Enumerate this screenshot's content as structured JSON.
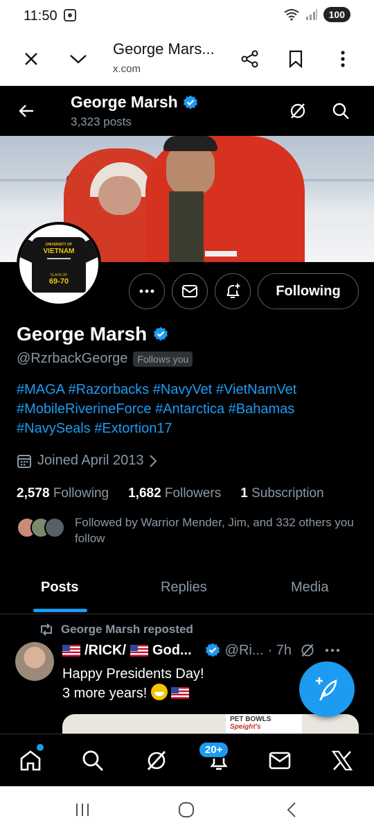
{
  "status_bar": {
    "time": "11:50",
    "battery": "100"
  },
  "browser": {
    "title": "George Mars...",
    "url": "x.com"
  },
  "header": {
    "name": "George Marsh",
    "posts_count": "3,323 posts"
  },
  "profile": {
    "name": "George Marsh",
    "handle": "@RzrbackGeorge",
    "follows_you": "Follows you",
    "bio_line1": "#MAGA #Razorbacks #NavyVet #VietNamVet",
    "bio_line2": "#MobileRiverineForce #Antarctica #Bahamas",
    "bio_line3": "#NavySeals #Extortion17",
    "joined": "Joined April 2013",
    "following_count": "2,578",
    "following_label": "Following",
    "followers_count": "1,682",
    "followers_label": "Followers",
    "subscription_count": "1",
    "subscription_label": "Subscription",
    "followed_by": "Followed by Warrior Mender, Jim, and 332 others you follow",
    "following_button": "Following",
    "avatar_shirt": {
      "line1": "UNIVERSITY OF",
      "line2": "VIETNAM",
      "line3": "CLASS OF",
      "line4": "69-70"
    }
  },
  "tabs": {
    "posts": "Posts",
    "replies": "Replies",
    "media": "Media"
  },
  "post": {
    "repost_label": "George Marsh reposted",
    "author": "/RICK/",
    "author_suffix": "God...",
    "handle": "@Ri...",
    "time": "· 7h",
    "line1": "Happy Presidents Day!",
    "line2": "3 more years!",
    "media_sign_1": "PET BOWLS",
    "media_sign_2": "Speight's"
  },
  "bottom_nav": {
    "notifications_badge": "20+"
  },
  "colors": {
    "accent": "#1d9bf0",
    "background": "#000000",
    "muted": "#8b98a5"
  }
}
